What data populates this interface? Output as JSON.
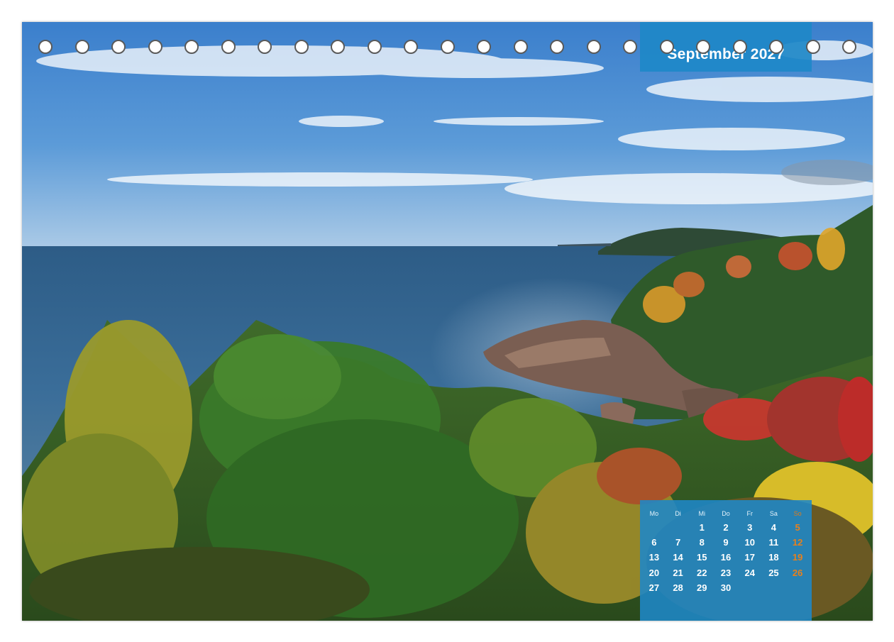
{
  "calendar": {
    "month_title": "September 2027",
    "weekdays": [
      "Mo",
      "Di",
      "Mi",
      "Do",
      "Fr",
      "Sa",
      "So"
    ],
    "weeks": [
      [
        "",
        "",
        "1",
        "2",
        "3",
        "4",
        "5"
      ],
      [
        "6",
        "7",
        "8",
        "9",
        "10",
        "11",
        "12"
      ],
      [
        "13",
        "14",
        "15",
        "16",
        "17",
        "18",
        "19"
      ],
      [
        "20",
        "21",
        "22",
        "23",
        "24",
        "25",
        "26"
      ],
      [
        "27",
        "28",
        "29",
        "30",
        "",
        "",
        ""
      ]
    ]
  },
  "colors": {
    "accent_blue": "#1e88c8",
    "sunday_orange": "#e8801c",
    "sky_blue": "#3d86cf",
    "sea_blue": "#2f5f88"
  }
}
